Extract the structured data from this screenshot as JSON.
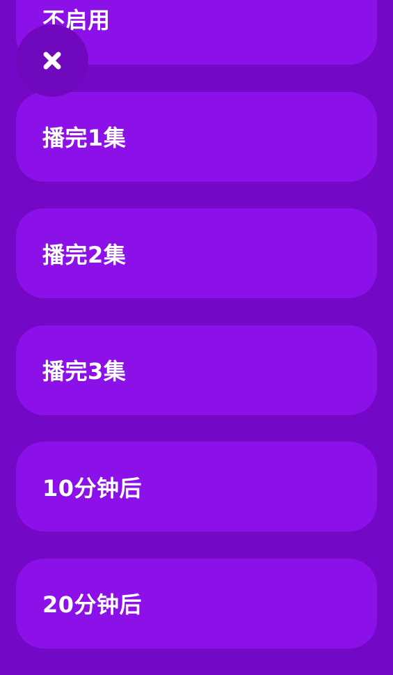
{
  "sleep_timer": {
    "options": [
      {
        "label": "不启用"
      },
      {
        "label": "播完1集"
      },
      {
        "label": "播完2集"
      },
      {
        "label": "播完3集"
      },
      {
        "label": "10分钟后"
      },
      {
        "label": "20分钟后"
      }
    ],
    "close_icon": "close-icon"
  },
  "colors": {
    "background": "#7308c6",
    "option_background": "#8c10e8",
    "close_button_background": "#7008be",
    "text": "#ffffff"
  }
}
